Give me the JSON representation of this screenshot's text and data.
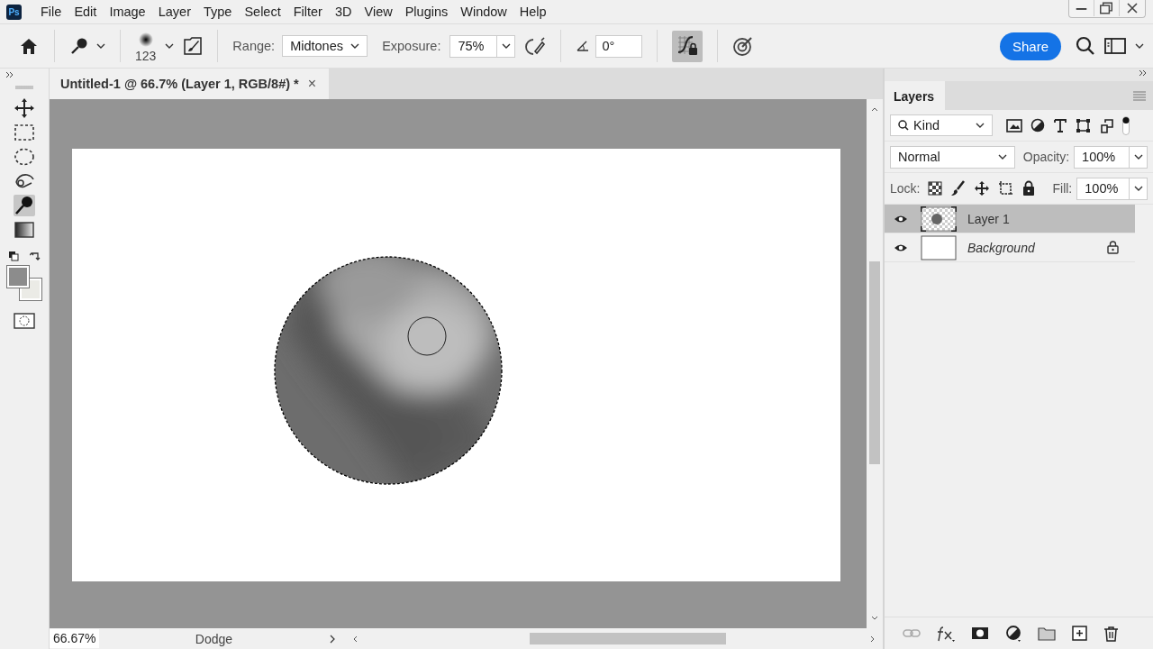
{
  "app_logo": "Ps",
  "menu": [
    "File",
    "Edit",
    "Image",
    "Layer",
    "Type",
    "Select",
    "Filter",
    "3D",
    "View",
    "Plugins",
    "Window",
    "Help"
  ],
  "options_bar": {
    "brush_size": "123",
    "range_label": "Range:",
    "range": "Midtones",
    "exposure_label": "Exposure:",
    "exposure": "75%",
    "angle": "0°",
    "protect_tones": {
      "on": true
    },
    "share": "Share"
  },
  "tools": [
    {
      "kind": "move",
      "selected": false
    },
    {
      "kind": "marquee",
      "selected": false
    },
    {
      "kind": "ellipse",
      "selected": false
    },
    {
      "kind": "object-select",
      "selected": false
    },
    {
      "kind": "dodge",
      "selected": true
    },
    {
      "kind": "gradient",
      "selected": false
    }
  ],
  "document_tab": {
    "title": "Untitled-1 @ 66.7% (Layer 1, RGB/8#) *",
    "close": "×"
  },
  "status_bar": {
    "zoom": "66.67%",
    "tool": "Dodge"
  },
  "layers_panel": {
    "tab": "Layers",
    "filter": "Kind",
    "blend_mode": "Normal",
    "opacity_label": "Opacity:",
    "opacity": "100%",
    "lock_label": "Lock:",
    "fill_label": "Fill:",
    "fill": "100%",
    "layers": [
      {
        "kind": "layer",
        "name": "Layer 1",
        "selected": true,
        "visible": true,
        "locked": false
      },
      {
        "kind": "background",
        "name": "Background",
        "selected": false,
        "visible": true,
        "locked": true
      }
    ]
  }
}
